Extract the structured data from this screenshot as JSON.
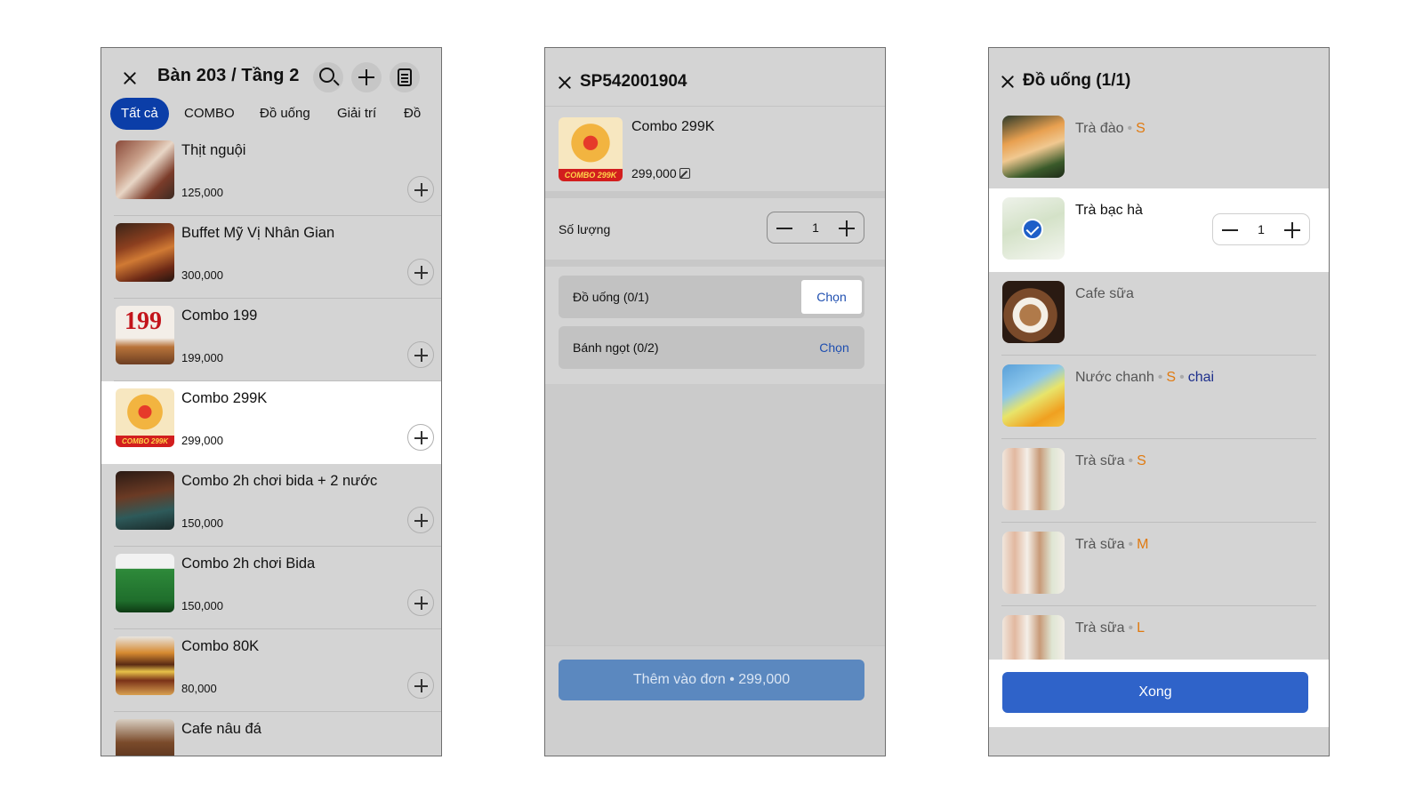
{
  "screen1": {
    "title": "Bàn 203 / Tầng 2",
    "tabs": [
      "Tất cả",
      "COMBO",
      "Đồ uống",
      "Giải trí",
      "Đồ"
    ],
    "products": [
      {
        "name": "Thịt nguội",
        "price": "125,000"
      },
      {
        "name": "Buffet Mỹ Vị Nhân Gian",
        "price": "300,000"
      },
      {
        "name": "Combo 199",
        "price": "199,000"
      },
      {
        "name": "Combo 299K",
        "price": "299,000"
      },
      {
        "name": "Combo 2h chơi bida + 2 nước",
        "price": "150,000"
      },
      {
        "name": "Combo 2h chơi Bida",
        "price": "150,000"
      },
      {
        "name": "Combo 80K",
        "price": "80,000"
      },
      {
        "name": "Cafe nâu đá",
        "price": ""
      }
    ],
    "thumb_badges": {
      "combo199": "199",
      "combo299": "COMBO 299K"
    }
  },
  "screen2": {
    "title": "SP542001904",
    "product_name": "Combo 299K",
    "product_price": "299,000",
    "qty_label": "Số lượng",
    "qty_value": "1",
    "groups": [
      {
        "label": "Đồ uống (0/1)",
        "action": "Chọn"
      },
      {
        "label": "Bánh ngọt (0/2)",
        "action": "Chọn"
      }
    ],
    "add_button": "Thêm vào đơn • 299,000"
  },
  "screen3": {
    "title": "Đồ uống (1/1)",
    "drinks": [
      {
        "name": "Trà đào",
        "size": "S",
        "unit": ""
      },
      {
        "name": "Trà bạc hà",
        "size": "",
        "unit": ""
      },
      {
        "name": "Cafe sữa",
        "size": "",
        "unit": ""
      },
      {
        "name": "Nước chanh",
        "size": "S",
        "unit": "chai"
      },
      {
        "name": "Trà sữa",
        "size": "S",
        "unit": ""
      },
      {
        "name": "Trà sữa",
        "size": "M",
        "unit": ""
      },
      {
        "name": "Trà sữa",
        "size": "L",
        "unit": ""
      }
    ],
    "selected_qty": "1",
    "done_button": "Xong"
  },
  "colors": {
    "primary": "#2f63c9",
    "tab_active": "#0b3ea8",
    "size_accent": "#e07a10",
    "link": "#1f4fb0"
  }
}
